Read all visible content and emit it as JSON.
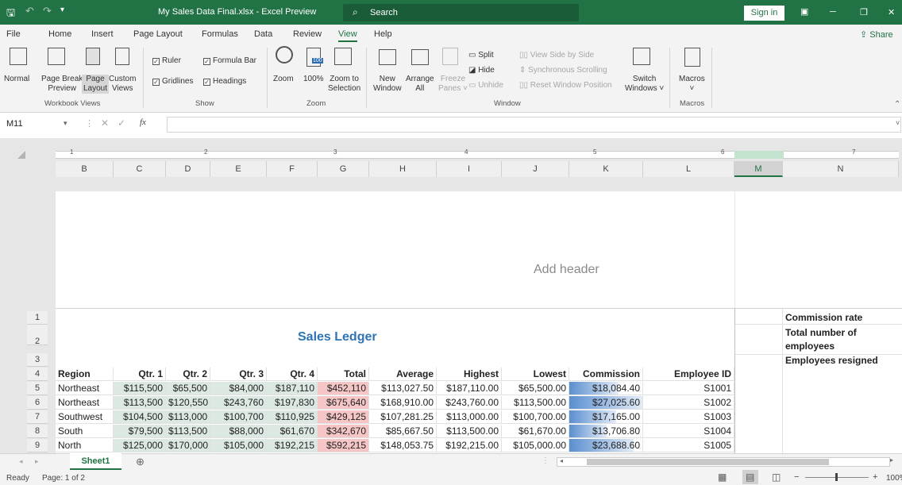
{
  "titlebar": {
    "undo": "↶",
    "redo": "↷",
    "doc_title": "My Sales Data Final.xlsx  -  Excel Preview",
    "search": "Search",
    "sign_in": "Sign in",
    "minimize": "─",
    "restore": "❐",
    "close": "✕"
  },
  "menu": {
    "items": [
      "File",
      "Home",
      "Insert",
      "Page Layout",
      "Formulas",
      "Data",
      "Review",
      "View",
      "Help"
    ],
    "active": "View",
    "share": "Share"
  },
  "ribbon": {
    "workbook_views": {
      "normal": "Normal",
      "page_break_1": "Page Break",
      "page_break_2": "Preview",
      "page_layout_1": "Page",
      "page_layout_2": "Layout",
      "custom_1": "Custom",
      "custom_2": "Views",
      "group": "Workbook Views"
    },
    "show": {
      "ruler": "Ruler",
      "formula_bar": "Formula Bar",
      "gridlines": "Gridlines",
      "headings": "Headings",
      "group": "Show"
    },
    "zoom": {
      "zoom": "Zoom",
      "hundred": "100%",
      "zoom_sel_1": "Zoom to",
      "zoom_sel_2": "Selection",
      "group": "Zoom",
      "icon_label": "100"
    },
    "window": {
      "new_1": "New",
      "new_2": "Window",
      "arrange_1": "Arrange",
      "arrange_2": "All",
      "freeze_1": "Freeze",
      "freeze_2": "Panes ˅",
      "split": "Split",
      "hide": "Hide",
      "unhide": "Unhide",
      "side_by_side": "View Side by Side",
      "sync_scroll": "Synchronous Scrolling",
      "reset_pos": "Reset Window Position",
      "switch_1": "Switch",
      "switch_2": "Windows ˅",
      "group": "Window"
    },
    "macros": {
      "label": "Macros",
      "arrow": "˅",
      "group": "Macros"
    }
  },
  "formula_bar": {
    "name_box": "M11",
    "fx": "fx",
    "value": ""
  },
  "ruler": {
    "marks": [
      "1",
      "2",
      "3",
      "4",
      "5",
      "6",
      "7"
    ]
  },
  "columns": [
    "B",
    "C",
    "D",
    "E",
    "F",
    "G",
    "H",
    "I",
    "J",
    "K",
    "L",
    "M",
    "N"
  ],
  "page": {
    "add_header": "Add header",
    "title": "Sales Ledger"
  },
  "side_labels": {
    "commission_rate": "Commission rate",
    "total_emp_1": "Total number of",
    "total_emp_2": "employees",
    "resigned": "Employees resigned"
  },
  "rows": [
    "1",
    "2",
    "3",
    "4",
    "5",
    "6",
    "7",
    "8",
    "9"
  ],
  "table": {
    "headers": [
      "Region",
      "Qtr. 1",
      "Qtr. 2",
      "Qtr. 3",
      "Qtr. 4",
      "Total",
      "Average",
      "Highest",
      "Lowest",
      "Commission",
      "Employee ID"
    ],
    "data": [
      [
        "Northeast",
        "$115,500",
        "$65,500",
        "$84,000",
        "$187,110",
        "$452,110",
        "$113,027.50",
        "$187,110.00",
        "$65,500.00",
        "$18,084.40",
        "S1001"
      ],
      [
        "Northeast",
        "$113,500",
        "$120,550",
        "$243,760",
        "$197,830",
        "$675,640",
        "$168,910.00",
        "$243,760.00",
        "$113,500.00",
        "$27,025.60",
        "S1002"
      ],
      [
        "Southwest",
        "$104,500",
        "$113,000",
        "$100,700",
        "$110,925",
        "$429,125",
        "$107,281.25",
        "$113,000.00",
        "$100,700.00",
        "$17,165.00",
        "S1003"
      ],
      [
        "South",
        "$79,500",
        "$113,500",
        "$88,000",
        "$61,670",
        "$342,670",
        "$85,667.50",
        "$113,500.00",
        "$61,670.00",
        "$13,706.80",
        "S1004"
      ],
      [
        "North",
        "$125,000",
        "$170,000",
        "$105,000",
        "$192,215",
        "$592,215",
        "$148,053.75",
        "$192,215.00",
        "$105,000.00",
        "$23,688.60",
        "S1005"
      ]
    ],
    "commission_bar_fraction": [
      0.67,
      1.0,
      0.64,
      0.51,
      0.88
    ]
  },
  "tabs": {
    "sheet1": "Sheet1",
    "add": "⊕"
  },
  "status": {
    "ready": "Ready",
    "page": "Page: 1 of 2",
    "zoom": "100%"
  },
  "colors": {
    "excel_green": "#217346",
    "pink_fill": "#f6c6c6",
    "green_fill": "#dce9e2",
    "databar": "#5b8fd0"
  }
}
